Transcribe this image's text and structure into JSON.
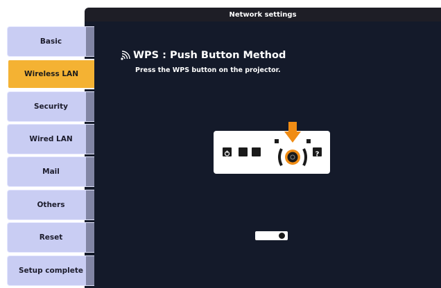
{
  "window": {
    "title": "Network settings"
  },
  "sidebar": {
    "items": [
      {
        "label": "Basic",
        "active": false
      },
      {
        "label": "Wireless LAN",
        "active": true
      },
      {
        "label": "Security",
        "active": false
      },
      {
        "label": "Wired LAN",
        "active": false
      },
      {
        "label": "Mail",
        "active": false
      },
      {
        "label": "Others",
        "active": false
      },
      {
        "label": "Reset",
        "active": false
      },
      {
        "label": "Setup complete",
        "active": false
      }
    ]
  },
  "main": {
    "heading": "WPS : Push Button Method",
    "instruction": "Press the WPS button on the projector.",
    "heading_icon": "wps-signal-icon",
    "illustration": {
      "buttons": [
        "power-icon",
        "square-button-icon",
        "square-button-icon",
        "wps-button-icon",
        "help-icon"
      ],
      "highlighted_button": "wps-button-icon",
      "arrow_icon": "arrow-down-icon"
    },
    "status_icon": "toggle-indicator-icon"
  },
  "colors": {
    "accent_active_tab": "#f4b233",
    "tab_default": "#c9cdf3",
    "panel_background": "#141a2a",
    "highlight": "#f08c14"
  }
}
